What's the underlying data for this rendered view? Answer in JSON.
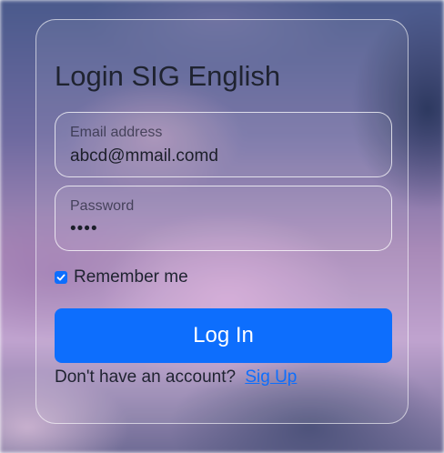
{
  "form": {
    "title": "Login SIG English",
    "email": {
      "label": "Email address",
      "value": "abcd@mmail.comd"
    },
    "password": {
      "label": "Password",
      "value": "••••"
    },
    "remember": {
      "label": "Remember me",
      "checked": true
    },
    "submit_label": "Log In",
    "signup_prompt": "Don't have an account?",
    "signup_link": "Sig Up"
  },
  "colors": {
    "accent": "#0d6efd",
    "text": "#1f2330"
  },
  "icons": {
    "checkbox": "checkmark-icon"
  }
}
